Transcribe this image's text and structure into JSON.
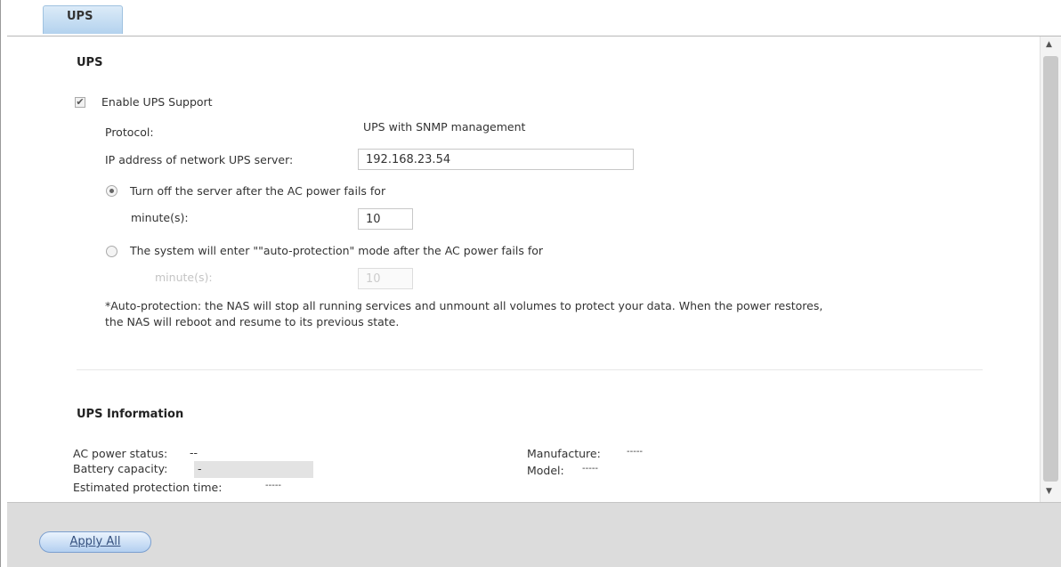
{
  "tab": {
    "label": "UPS"
  },
  "section": {
    "title": "UPS"
  },
  "enable": {
    "label": "Enable UPS Support",
    "checked": true
  },
  "protocol": {
    "label": "Protocol:",
    "value": "UPS with SNMP management"
  },
  "ip": {
    "label": "IP address of network UPS server:",
    "value": "192.168.23.54"
  },
  "option_turnoff": {
    "label": "Turn off the server after the AC power fails for",
    "minutes_label": "minute(s):",
    "minutes": "10",
    "selected": true
  },
  "option_autoprotect": {
    "label": "The system will enter \"\"auto-protection\" mode after the AC power fails for",
    "minutes_label": "minute(s):",
    "minutes": "10",
    "selected": false
  },
  "note": {
    "line1": "*Auto-protection: the NAS will stop all running services and unmount all volumes to protect your data. When the power restores,",
    "line2": "the NAS will reboot and resume to its previous state."
  },
  "info": {
    "title": "UPS Information",
    "ac_label": "AC power status:",
    "ac_value": "--",
    "battery_label": "Battery capacity:",
    "battery_value": "-",
    "estimated_label": "Estimated protection time:",
    "estimated_value": "-----",
    "manufacture_label": "Manufacture:",
    "manufacture_value": "-----",
    "model_label": "Model:",
    "model_value": "-----"
  },
  "footer": {
    "apply_label": "Apply All"
  },
  "icons": {
    "checkbox": "check-mark",
    "scroll_up": "triangle-up",
    "scroll_down": "triangle-down"
  }
}
